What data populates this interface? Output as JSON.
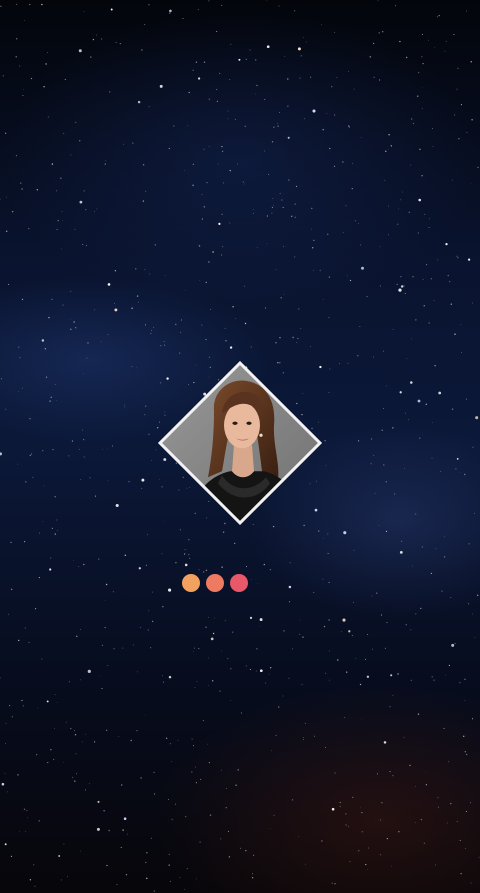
{
  "screen": {
    "name": "splash-screen",
    "background": "starry-night-sky"
  },
  "avatar": {
    "shape": "diamond",
    "border_color": "#f2f2f2",
    "subject": "profile-photo"
  },
  "loading_indicator": {
    "dot_count": 3,
    "dot_colors": [
      "#f2a25e",
      "#ef7a62",
      "#e85868"
    ]
  }
}
